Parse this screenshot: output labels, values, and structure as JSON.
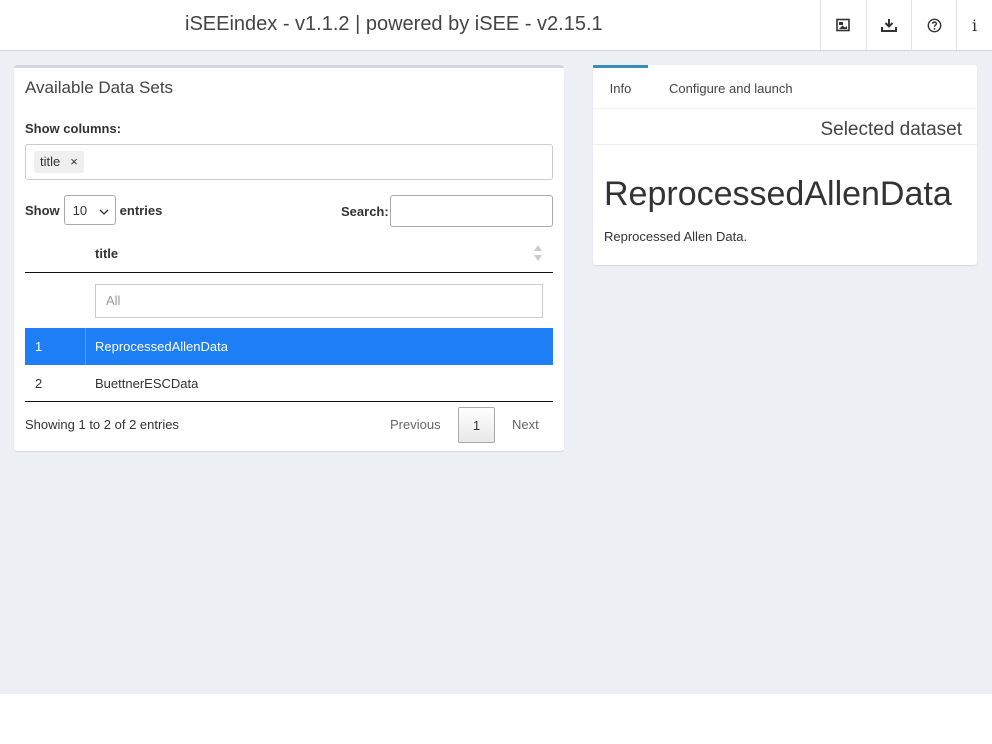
{
  "header": {
    "title": "iSEEindex - v1.1.2 | powered by iSEE - v2.15.1",
    "buttons": [
      {
        "icon": "image-export-icon"
      },
      {
        "icon": "download-icon"
      },
      {
        "icon": "question-circle-icon"
      },
      {
        "icon": "info-icon",
        "glyph": "i"
      }
    ]
  },
  "datasets_box": {
    "title": "Available Data Sets",
    "show_columns_label": "Show columns:",
    "selected_columns": [
      {
        "label": "title",
        "remove": "×"
      }
    ],
    "length": {
      "show_label": "Show",
      "value": "10",
      "entries_label": "entries"
    },
    "search": {
      "label": "Search:",
      "value": ""
    },
    "table": {
      "header": "title",
      "filter_placeholder": "All",
      "rows": [
        {
          "num": "1",
          "title": "ReprocessedAllenData",
          "selected": true
        },
        {
          "num": "2",
          "title": "BuettnerESCData",
          "selected": false
        }
      ]
    },
    "info": "Showing 1 to 2 of 2 entries",
    "pagination": {
      "previous": "Previous",
      "current": "1",
      "next": "Next"
    }
  },
  "details_box": {
    "tabs": [
      {
        "label": "Info",
        "active": true
      },
      {
        "label": "Configure and launch",
        "active": false
      }
    ],
    "selected_heading": "Selected dataset",
    "dataset_name": "ReprocessedAllenData",
    "dataset_description": "Reprocessed Allen Data."
  },
  "colors": {
    "accent": "#3c8dbc",
    "selected_row": "#1e7ef5",
    "content_bg": "#ecf0f5"
  }
}
